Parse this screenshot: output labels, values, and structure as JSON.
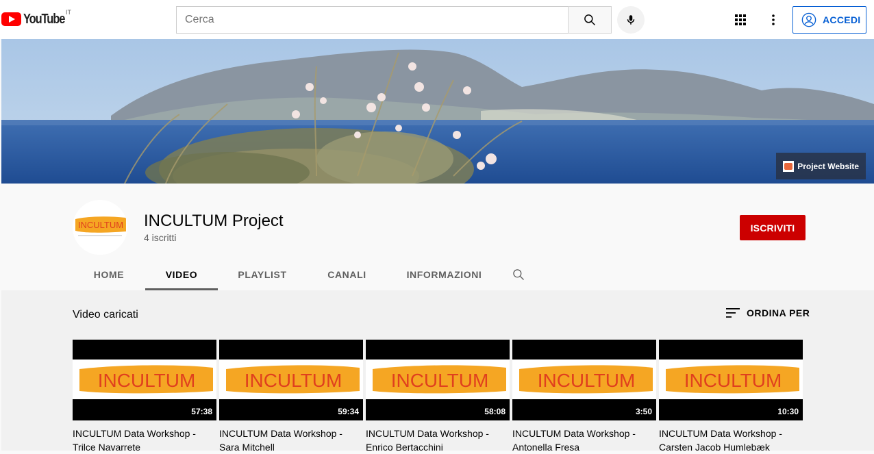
{
  "header": {
    "logo_text": "YouTube",
    "country_code": "IT",
    "search_placeholder": "Cerca",
    "signin_label": "ACCEDI"
  },
  "banner": {
    "link_label": "Project Website"
  },
  "channel": {
    "name": "INCULTUM Project",
    "subscribers": "4 iscritti",
    "subscribe_label": "ISCRIVITI",
    "avatar_text": "INCULTUM"
  },
  "tabs": [
    {
      "label": "HOME",
      "active": false
    },
    {
      "label": "VIDEO",
      "active": true
    },
    {
      "label": "PLAYLIST",
      "active": false
    },
    {
      "label": "CANALI",
      "active": false
    },
    {
      "label": "INFORMAZIONI",
      "active": false
    }
  ],
  "uploads": {
    "title": "Video caricati",
    "sort_label": "ORDINA PER",
    "videos": [
      {
        "thumb_text": "INCULTUM",
        "duration": "57:38",
        "title_line1": "INCULTUM Data Workshop -",
        "title_line2": "Trilce Navarrete"
      },
      {
        "thumb_text": "INCULTUM",
        "duration": "59:34",
        "title_line1": "INCULTUM Data Workshop -",
        "title_line2": "Sara Mitchell"
      },
      {
        "thumb_text": "INCULTUM",
        "duration": "58:08",
        "title_line1": "INCULTUM Data Workshop -",
        "title_line2": "Enrico Bertacchini"
      },
      {
        "thumb_text": "INCULTUM",
        "duration": "3:50",
        "title_line1": "INCULTUM Data Workshop -",
        "title_line2": "Antonella Fresa"
      },
      {
        "thumb_text": "INCULTUM",
        "duration": "10:30",
        "title_line1": "INCULTUM Data Workshop -",
        "title_line2": "Carsten Jacob Humlebæk"
      }
    ]
  },
  "colors": {
    "brand_red": "#ff0000",
    "subscribe_red": "#cc0000",
    "link_blue": "#065fd4",
    "logo_orange": "#f5a623",
    "logo_text_red": "#e0401e"
  },
  "icons": [
    "youtube-logo-icon",
    "search-icon",
    "mic-icon",
    "apps-icon",
    "more-vert-icon",
    "account-icon",
    "sort-icon",
    "channel-search-icon"
  ]
}
